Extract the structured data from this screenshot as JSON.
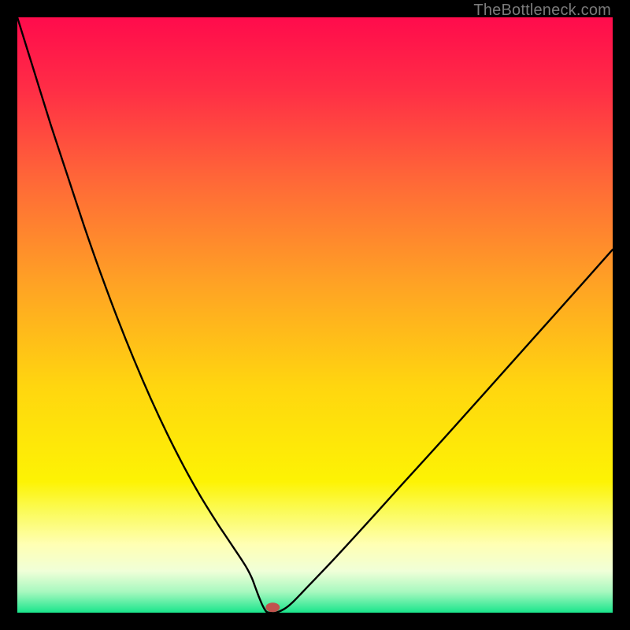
{
  "watermark": "TheBottleneck.com",
  "chart_data": {
    "type": "line",
    "title": "",
    "xlabel": "",
    "ylabel": "",
    "xlim": [
      0,
      100
    ],
    "ylim": [
      0,
      100
    ],
    "grid": false,
    "legend": false,
    "background_gradient": {
      "stops": [
        {
          "offset": 0.0,
          "color": "#ff0b4c"
        },
        {
          "offset": 0.12,
          "color": "#ff2d46"
        },
        {
          "offset": 0.28,
          "color": "#ff6a37"
        },
        {
          "offset": 0.45,
          "color": "#ffa324"
        },
        {
          "offset": 0.62,
          "color": "#ffd60f"
        },
        {
          "offset": 0.78,
          "color": "#fdf304"
        },
        {
          "offset": 0.83,
          "color": "#fbfb5a"
        },
        {
          "offset": 0.885,
          "color": "#ffffb3"
        },
        {
          "offset": 0.93,
          "color": "#f0ffd8"
        },
        {
          "offset": 0.965,
          "color": "#a7f8bf"
        },
        {
          "offset": 1.0,
          "color": "#19e58b"
        }
      ]
    },
    "series": [
      {
        "name": "bottleneck-curve",
        "x": [
          0.0,
          2.8,
          5.6,
          8.4,
          11.2,
          14.0,
          16.8,
          19.6,
          22.4,
          25.2,
          28.0,
          30.8,
          33.6,
          35.0,
          36.4,
          37.8,
          38.6,
          39.4,
          40.0,
          40.6,
          41.2,
          41.8,
          42.4,
          43.4,
          44.8,
          46.2,
          49.0,
          53.2,
          58.8,
          64.4,
          71.4,
          78.4,
          86.8,
          95.2,
          100.0
        ],
        "y": [
          100.0,
          91.0,
          82.0,
          73.5,
          65.0,
          57.0,
          49.5,
          42.5,
          36.0,
          30.0,
          24.5,
          19.5,
          15.0,
          12.9,
          10.8,
          8.7,
          7.4,
          5.8,
          4.2,
          2.6,
          1.2,
          0.2,
          0.0,
          0.0,
          0.6,
          1.7,
          4.6,
          9.0,
          15.1,
          21.3,
          29.0,
          36.8,
          46.2,
          55.6,
          61.0
        ]
      }
    ],
    "marker": {
      "name": "optimal-point",
      "x": 42.9,
      "y": 0.9,
      "color": "#c1534e",
      "rx": 9,
      "ry": 6
    }
  }
}
